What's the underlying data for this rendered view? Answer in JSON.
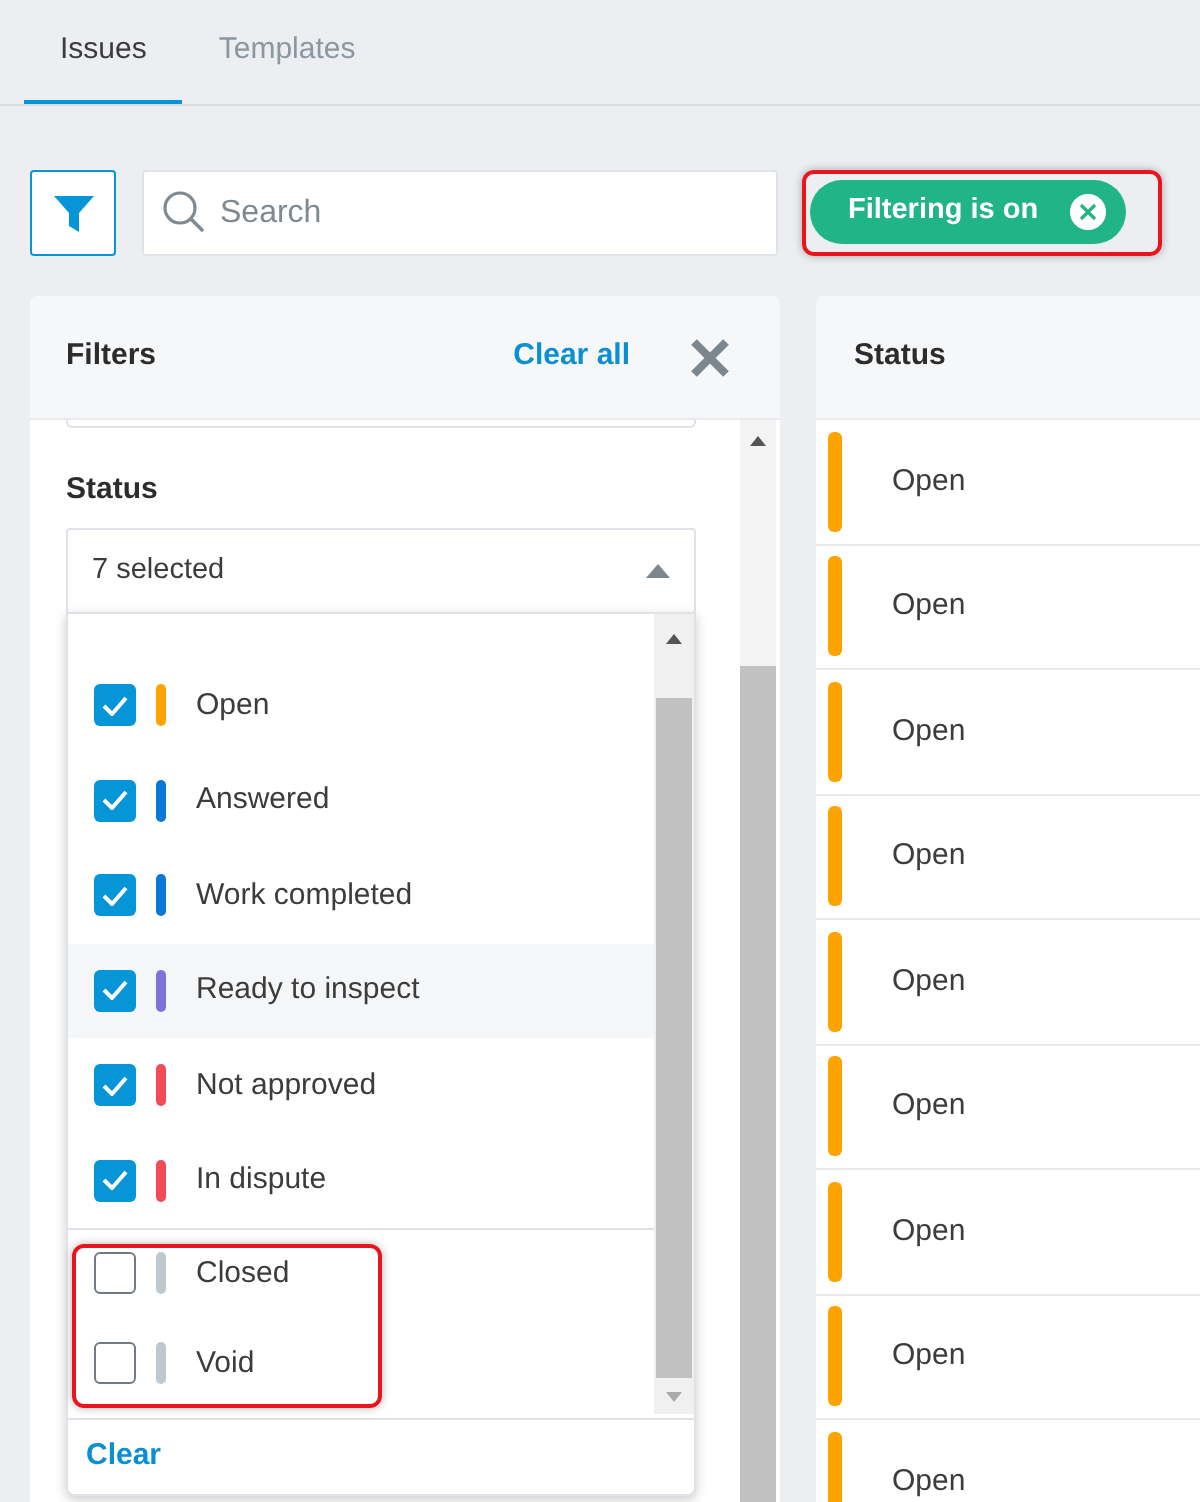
{
  "tabs": [
    {
      "label": "Issues",
      "selected": true
    },
    {
      "label": "Templates",
      "selected": false
    }
  ],
  "toolbar": {
    "search": {
      "placeholder": "Search"
    },
    "filter_chip": {
      "label": "Filtering is on",
      "highlighted": true
    }
  },
  "filters_panel": {
    "title": "Filters",
    "clear_all": "Clear all",
    "status_filter": {
      "label": "Status",
      "value": "7 selected",
      "expanded": true,
      "options": [
        {
          "label": "Open",
          "checked": true,
          "color": "#ffa300",
          "hovered": false,
          "highlighted": false
        },
        {
          "label": "Answered",
          "checked": true,
          "color": "#0a78d6",
          "hovered": false,
          "highlighted": false
        },
        {
          "label": "Work completed",
          "checked": true,
          "color": "#0a78d6",
          "hovered": false,
          "highlighted": false
        },
        {
          "label": "Ready to inspect",
          "checked": true,
          "color": "#7d72d8",
          "hovered": true,
          "highlighted": false
        },
        {
          "label": "Not approved",
          "checked": true,
          "color": "#f34a58",
          "hovered": false,
          "highlighted": false
        },
        {
          "label": "In dispute",
          "checked": true,
          "color": "#f34a58",
          "hovered": false,
          "highlighted": false
        },
        {
          "label": "Closed",
          "checked": false,
          "color": "#bec8d1",
          "hovered": false,
          "highlighted": true
        },
        {
          "label": "Void",
          "checked": false,
          "color": "#bec8d1",
          "hovered": false,
          "highlighted": true
        }
      ],
      "clear": "Clear"
    }
  },
  "table": {
    "columns": [
      "Status"
    ],
    "rows": [
      {
        "status": "Open",
        "color": "#ffa300"
      },
      {
        "status": "Open",
        "color": "#ffa300"
      },
      {
        "status": "Open",
        "color": "#ffa300"
      },
      {
        "status": "Open",
        "color": "#ffa300"
      },
      {
        "status": "Open",
        "color": "#ffa300"
      },
      {
        "status": "Open",
        "color": "#ffa300"
      },
      {
        "status": "Open",
        "color": "#ffa300"
      },
      {
        "status": "Open",
        "color": "#ffa300"
      },
      {
        "status": "Open",
        "color": "#ffa300"
      }
    ]
  }
}
